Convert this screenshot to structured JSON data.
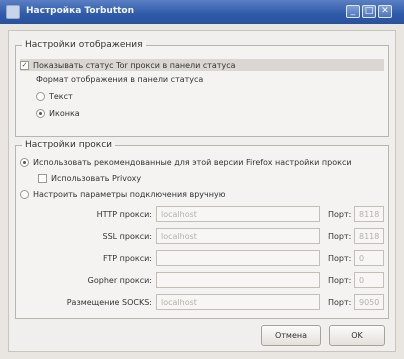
{
  "window": {
    "title": "Настройка Torbutton",
    "controls": [
      "_",
      "□",
      "✕"
    ]
  },
  "display_group": {
    "title": "Настройки отображения",
    "show_status_label": "Показывать статус Tor прокси в панели статуса",
    "show_status_checked": true,
    "format_label": "Формат отображения в панели статуса",
    "options": [
      {
        "label": "Текст",
        "selected": false
      },
      {
        "label": "Иконка",
        "selected": true
      }
    ]
  },
  "proxy_group": {
    "title": "Настройки прокси",
    "use_recommended_label": "Использовать рекомендованные для этой версии Firefox настройки прокси",
    "use_recommended_selected": true,
    "use_privoxy_label": "Использовать Privoxy",
    "use_privoxy_checked": false,
    "manual_label": "Настроить параметры подключения вручную",
    "manual_selected": false,
    "port_label": "Порт:",
    "fields": [
      {
        "label": "HTTP прокси:",
        "value": "localhost",
        "port": "8118"
      },
      {
        "label": "SSL прокси:",
        "value": "localhost",
        "port": "8118"
      },
      {
        "label": "FTP прокси:",
        "value": "",
        "port": "0"
      },
      {
        "label": "Gopher прокси:",
        "value": "",
        "port": "0"
      },
      {
        "label": "Размещение SOCKS:",
        "value": "localhost",
        "port": "9050"
      }
    ]
  },
  "buttons": {
    "cancel": "Отмена",
    "ok": "OK"
  }
}
